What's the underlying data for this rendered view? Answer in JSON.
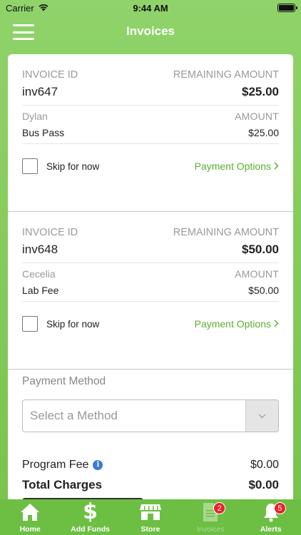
{
  "status_bar": {
    "carrier": "Carrier",
    "time": "9:44 AM"
  },
  "nav": {
    "title": "Invoices"
  },
  "invoices": [
    {
      "id_label": "INVOICE ID",
      "remaining_label": "REMAINING AMOUNT",
      "id": "inv647",
      "remaining": "$25.00",
      "person": "Dylan",
      "amount_label": "AMOUNT",
      "item": "Bus Pass",
      "amount": "$25.00",
      "skip_label": "Skip for now",
      "payment_options": "Payment Options"
    },
    {
      "id_label": "INVOICE ID",
      "remaining_label": "REMAINING AMOUNT",
      "id": "inv648",
      "remaining": "$50.00",
      "person": "Cecelia",
      "amount_label": "AMOUNT",
      "item": "Lab Fee",
      "amount": "$50.00",
      "skip_label": "Skip for now",
      "payment_options": "Payment Options"
    }
  ],
  "payment": {
    "title": "Payment Method",
    "select_placeholder": "Select a Method",
    "program_fee_label": "Program Fee",
    "program_fee": "$0.00",
    "total_label": "Total Charges",
    "total": "$0.00"
  },
  "tabs": [
    {
      "label": "Home",
      "icon": "home-icon",
      "active": true
    },
    {
      "label": "Add Funds",
      "icon": "dollar-icon",
      "active": true
    },
    {
      "label": "Store",
      "icon": "store-icon",
      "active": true
    },
    {
      "label": "Invoices",
      "icon": "invoice-icon",
      "active": false,
      "badge": "2"
    },
    {
      "label": "Alerts",
      "icon": "bell-icon",
      "active": true,
      "badge": "5"
    }
  ],
  "colors": {
    "brand_green": "#6dbf44",
    "link_green": "#5dae2d",
    "badge_red": "#e8232a"
  }
}
